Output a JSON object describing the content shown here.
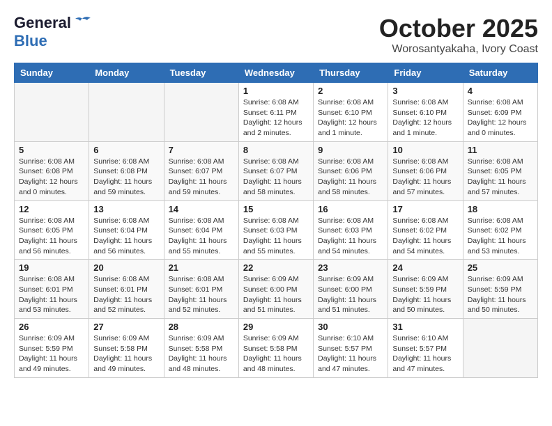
{
  "header": {
    "logo_line1": "General",
    "logo_line2": "Blue",
    "title": "October 2025",
    "subtitle": "Worosantyakaha, Ivory Coast"
  },
  "weekdays": [
    "Sunday",
    "Monday",
    "Tuesday",
    "Wednesday",
    "Thursday",
    "Friday",
    "Saturday"
  ],
  "weeks": [
    [
      {
        "day": "",
        "info": ""
      },
      {
        "day": "",
        "info": ""
      },
      {
        "day": "",
        "info": ""
      },
      {
        "day": "1",
        "info": "Sunrise: 6:08 AM\nSunset: 6:11 PM\nDaylight: 12 hours\nand 2 minutes."
      },
      {
        "day": "2",
        "info": "Sunrise: 6:08 AM\nSunset: 6:10 PM\nDaylight: 12 hours\nand 1 minute."
      },
      {
        "day": "3",
        "info": "Sunrise: 6:08 AM\nSunset: 6:10 PM\nDaylight: 12 hours\nand 1 minute."
      },
      {
        "day": "4",
        "info": "Sunrise: 6:08 AM\nSunset: 6:09 PM\nDaylight: 12 hours\nand 0 minutes."
      }
    ],
    [
      {
        "day": "5",
        "info": "Sunrise: 6:08 AM\nSunset: 6:08 PM\nDaylight: 12 hours\nand 0 minutes."
      },
      {
        "day": "6",
        "info": "Sunrise: 6:08 AM\nSunset: 6:08 PM\nDaylight: 11 hours\nand 59 minutes."
      },
      {
        "day": "7",
        "info": "Sunrise: 6:08 AM\nSunset: 6:07 PM\nDaylight: 11 hours\nand 59 minutes."
      },
      {
        "day": "8",
        "info": "Sunrise: 6:08 AM\nSunset: 6:07 PM\nDaylight: 11 hours\nand 58 minutes."
      },
      {
        "day": "9",
        "info": "Sunrise: 6:08 AM\nSunset: 6:06 PM\nDaylight: 11 hours\nand 58 minutes."
      },
      {
        "day": "10",
        "info": "Sunrise: 6:08 AM\nSunset: 6:06 PM\nDaylight: 11 hours\nand 57 minutes."
      },
      {
        "day": "11",
        "info": "Sunrise: 6:08 AM\nSunset: 6:05 PM\nDaylight: 11 hours\nand 57 minutes."
      }
    ],
    [
      {
        "day": "12",
        "info": "Sunrise: 6:08 AM\nSunset: 6:05 PM\nDaylight: 11 hours\nand 56 minutes."
      },
      {
        "day": "13",
        "info": "Sunrise: 6:08 AM\nSunset: 6:04 PM\nDaylight: 11 hours\nand 56 minutes."
      },
      {
        "day": "14",
        "info": "Sunrise: 6:08 AM\nSunset: 6:04 PM\nDaylight: 11 hours\nand 55 minutes."
      },
      {
        "day": "15",
        "info": "Sunrise: 6:08 AM\nSunset: 6:03 PM\nDaylight: 11 hours\nand 55 minutes."
      },
      {
        "day": "16",
        "info": "Sunrise: 6:08 AM\nSunset: 6:03 PM\nDaylight: 11 hours\nand 54 minutes."
      },
      {
        "day": "17",
        "info": "Sunrise: 6:08 AM\nSunset: 6:02 PM\nDaylight: 11 hours\nand 54 minutes."
      },
      {
        "day": "18",
        "info": "Sunrise: 6:08 AM\nSunset: 6:02 PM\nDaylight: 11 hours\nand 53 minutes."
      }
    ],
    [
      {
        "day": "19",
        "info": "Sunrise: 6:08 AM\nSunset: 6:01 PM\nDaylight: 11 hours\nand 53 minutes."
      },
      {
        "day": "20",
        "info": "Sunrise: 6:08 AM\nSunset: 6:01 PM\nDaylight: 11 hours\nand 52 minutes."
      },
      {
        "day": "21",
        "info": "Sunrise: 6:08 AM\nSunset: 6:01 PM\nDaylight: 11 hours\nand 52 minutes."
      },
      {
        "day": "22",
        "info": "Sunrise: 6:09 AM\nSunset: 6:00 PM\nDaylight: 11 hours\nand 51 minutes."
      },
      {
        "day": "23",
        "info": "Sunrise: 6:09 AM\nSunset: 6:00 PM\nDaylight: 11 hours\nand 51 minutes."
      },
      {
        "day": "24",
        "info": "Sunrise: 6:09 AM\nSunset: 5:59 PM\nDaylight: 11 hours\nand 50 minutes."
      },
      {
        "day": "25",
        "info": "Sunrise: 6:09 AM\nSunset: 5:59 PM\nDaylight: 11 hours\nand 50 minutes."
      }
    ],
    [
      {
        "day": "26",
        "info": "Sunrise: 6:09 AM\nSunset: 5:59 PM\nDaylight: 11 hours\nand 49 minutes."
      },
      {
        "day": "27",
        "info": "Sunrise: 6:09 AM\nSunset: 5:58 PM\nDaylight: 11 hours\nand 49 minutes."
      },
      {
        "day": "28",
        "info": "Sunrise: 6:09 AM\nSunset: 5:58 PM\nDaylight: 11 hours\nand 48 minutes."
      },
      {
        "day": "29",
        "info": "Sunrise: 6:09 AM\nSunset: 5:58 PM\nDaylight: 11 hours\nand 48 minutes."
      },
      {
        "day": "30",
        "info": "Sunrise: 6:10 AM\nSunset: 5:57 PM\nDaylight: 11 hours\nand 47 minutes."
      },
      {
        "day": "31",
        "info": "Sunrise: 6:10 AM\nSunset: 5:57 PM\nDaylight: 11 hours\nand 47 minutes."
      },
      {
        "day": "",
        "info": ""
      }
    ]
  ]
}
